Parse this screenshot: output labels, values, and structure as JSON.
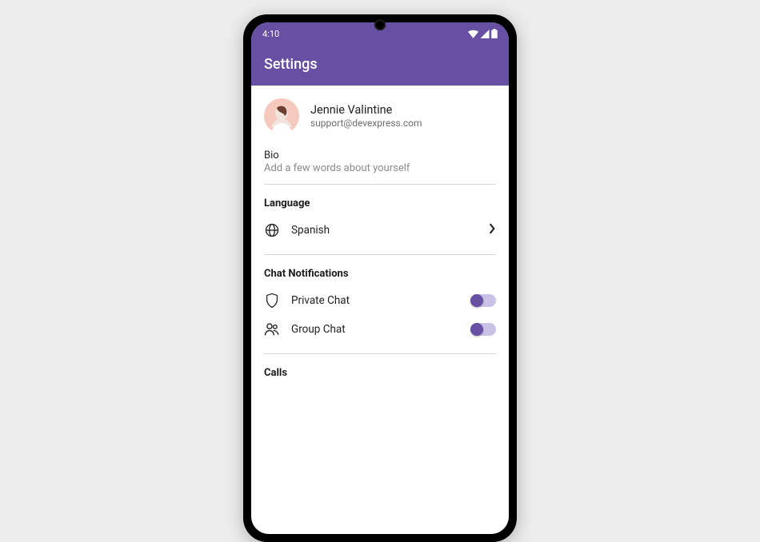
{
  "statusbar": {
    "time": "4:10"
  },
  "appbar": {
    "title": "Settings"
  },
  "profile": {
    "name": "Jennie Valintine",
    "email": "support@devexpress.com"
  },
  "bio": {
    "label": "Bio",
    "hint": "Add a few words about yourself"
  },
  "language": {
    "header": "Language",
    "value": "Spanish"
  },
  "chat": {
    "header": "Chat Notifications",
    "private_label": "Private Chat",
    "private_on": true,
    "group_label": "Group Chat",
    "group_on": true
  },
  "calls": {
    "header": "Calls"
  },
  "colors": {
    "accent": "#6750a4"
  }
}
